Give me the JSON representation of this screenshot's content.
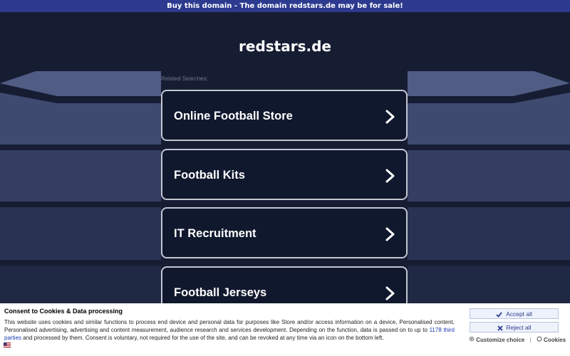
{
  "banner": {
    "text": "Buy this domain - The domain redstars.de may be for sale!"
  },
  "site": {
    "title": "redstars.de"
  },
  "related": {
    "label": "Related Searches:"
  },
  "searches": [
    {
      "label": "Online Football Store"
    },
    {
      "label": "Football Kits"
    },
    {
      "label": "IT Recruitment"
    },
    {
      "label": "Football Jerseys"
    }
  ],
  "consent": {
    "title": "Consent to Cookies & Data processing",
    "text_before_link": "This website uses cookies and similar functions to process end device and personal data for purposes like Store and/or access information on a device, Personalised content, Personalised advertising, advertising and content measurement, audience research and services development. Depending on the function, data is passed on to up to ",
    "link": "1178 third parties",
    "text_after_link": " and processed by them. Consent is voluntary, not required for the use of the site, and can be revoked at any time via an icon on the bottom left.",
    "accept_label": "Accept all",
    "reject_label": "Reject all",
    "customize_label": "Customize choice",
    "separator": "|",
    "cookies_label": "Cookies",
    "icons": [
      "check-icon",
      "x-icon",
      "gear-icon",
      "cookie-icon",
      "flag-icon"
    ]
  },
  "colors": {
    "banner": "#2c3a8f",
    "background": "#161d33",
    "card_border": "#c3c6d1",
    "link": "#1d3bb5"
  }
}
